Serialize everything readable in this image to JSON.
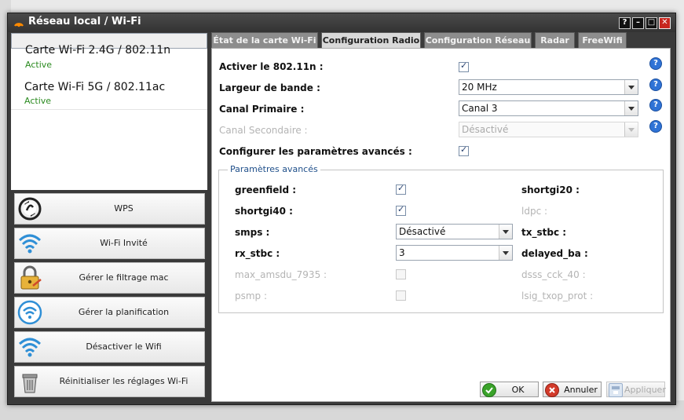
{
  "window": {
    "title": "Réseau local / Wi-Fi"
  },
  "title_buttons": [
    "?",
    "–",
    "□",
    "✕"
  ],
  "cards": [
    {
      "title": "Carte Wi-Fi 2.4G / 802.11n",
      "status": "Active"
    },
    {
      "title": "Carte Wi-Fi 5G / 802.11ac",
      "status": "Active"
    }
  ],
  "actions": [
    {
      "label": "WPS",
      "icon": "wps-icon"
    },
    {
      "label": "Wi-Fi Invité",
      "icon": "wifi-guest-icon"
    },
    {
      "label": "Gérer le filtrage mac",
      "icon": "lock-icon"
    },
    {
      "label": "Gérer la planification",
      "icon": "wifi-schedule-icon"
    },
    {
      "label": "Désactiver le Wifi",
      "icon": "wifi-icon"
    },
    {
      "label": "Réinitialiser les réglages Wi-Fi",
      "icon": "trash-icon"
    }
  ],
  "tabs": [
    "État de la carte Wi-Fi",
    "Configuration Radio",
    "Configuration Réseau",
    "Radar",
    "FreeWifi"
  ],
  "active_tab": "Configuration Radio",
  "form": {
    "enable_80211n_label": "Activer le 802.11n :",
    "bandwidth_label": "Largeur de bande :",
    "bandwidth_value": "20 MHz",
    "primary_channel_label": "Canal Primaire :",
    "primary_channel_value": "Canal 3",
    "secondary_channel_label": "Canal Secondaire :",
    "secondary_channel_value": "Désactivé",
    "advanced_label": "Configurer les paramètres avancés :"
  },
  "advanced": {
    "legend": "Paramètres avancés",
    "greenfield": "greenfield :",
    "shortgi40": "shortgi40 :",
    "smps": "smps :",
    "smps_value": "Désactivé",
    "rx_stbc": "rx_stbc :",
    "rx_stbc_value": "3",
    "max_amsdu": "max_amsdu_7935 :",
    "psmp": "psmp :",
    "shortgi20": "shortgi20 :",
    "ldpc": "ldpc :",
    "tx_stbc": "tx_stbc :",
    "delayed_ba": "delayed_ba :",
    "dsss_cck": "dsss_cck_40 :",
    "lsig": "lsig_txop_prot :"
  },
  "footer": {
    "ok": "OK",
    "cancel": "Annuler",
    "apply": "Appliquer"
  },
  "colors": {
    "accent": "#2f73d6",
    "active_green": "#2a8a1f",
    "title_bar": "#3a3a3a"
  }
}
